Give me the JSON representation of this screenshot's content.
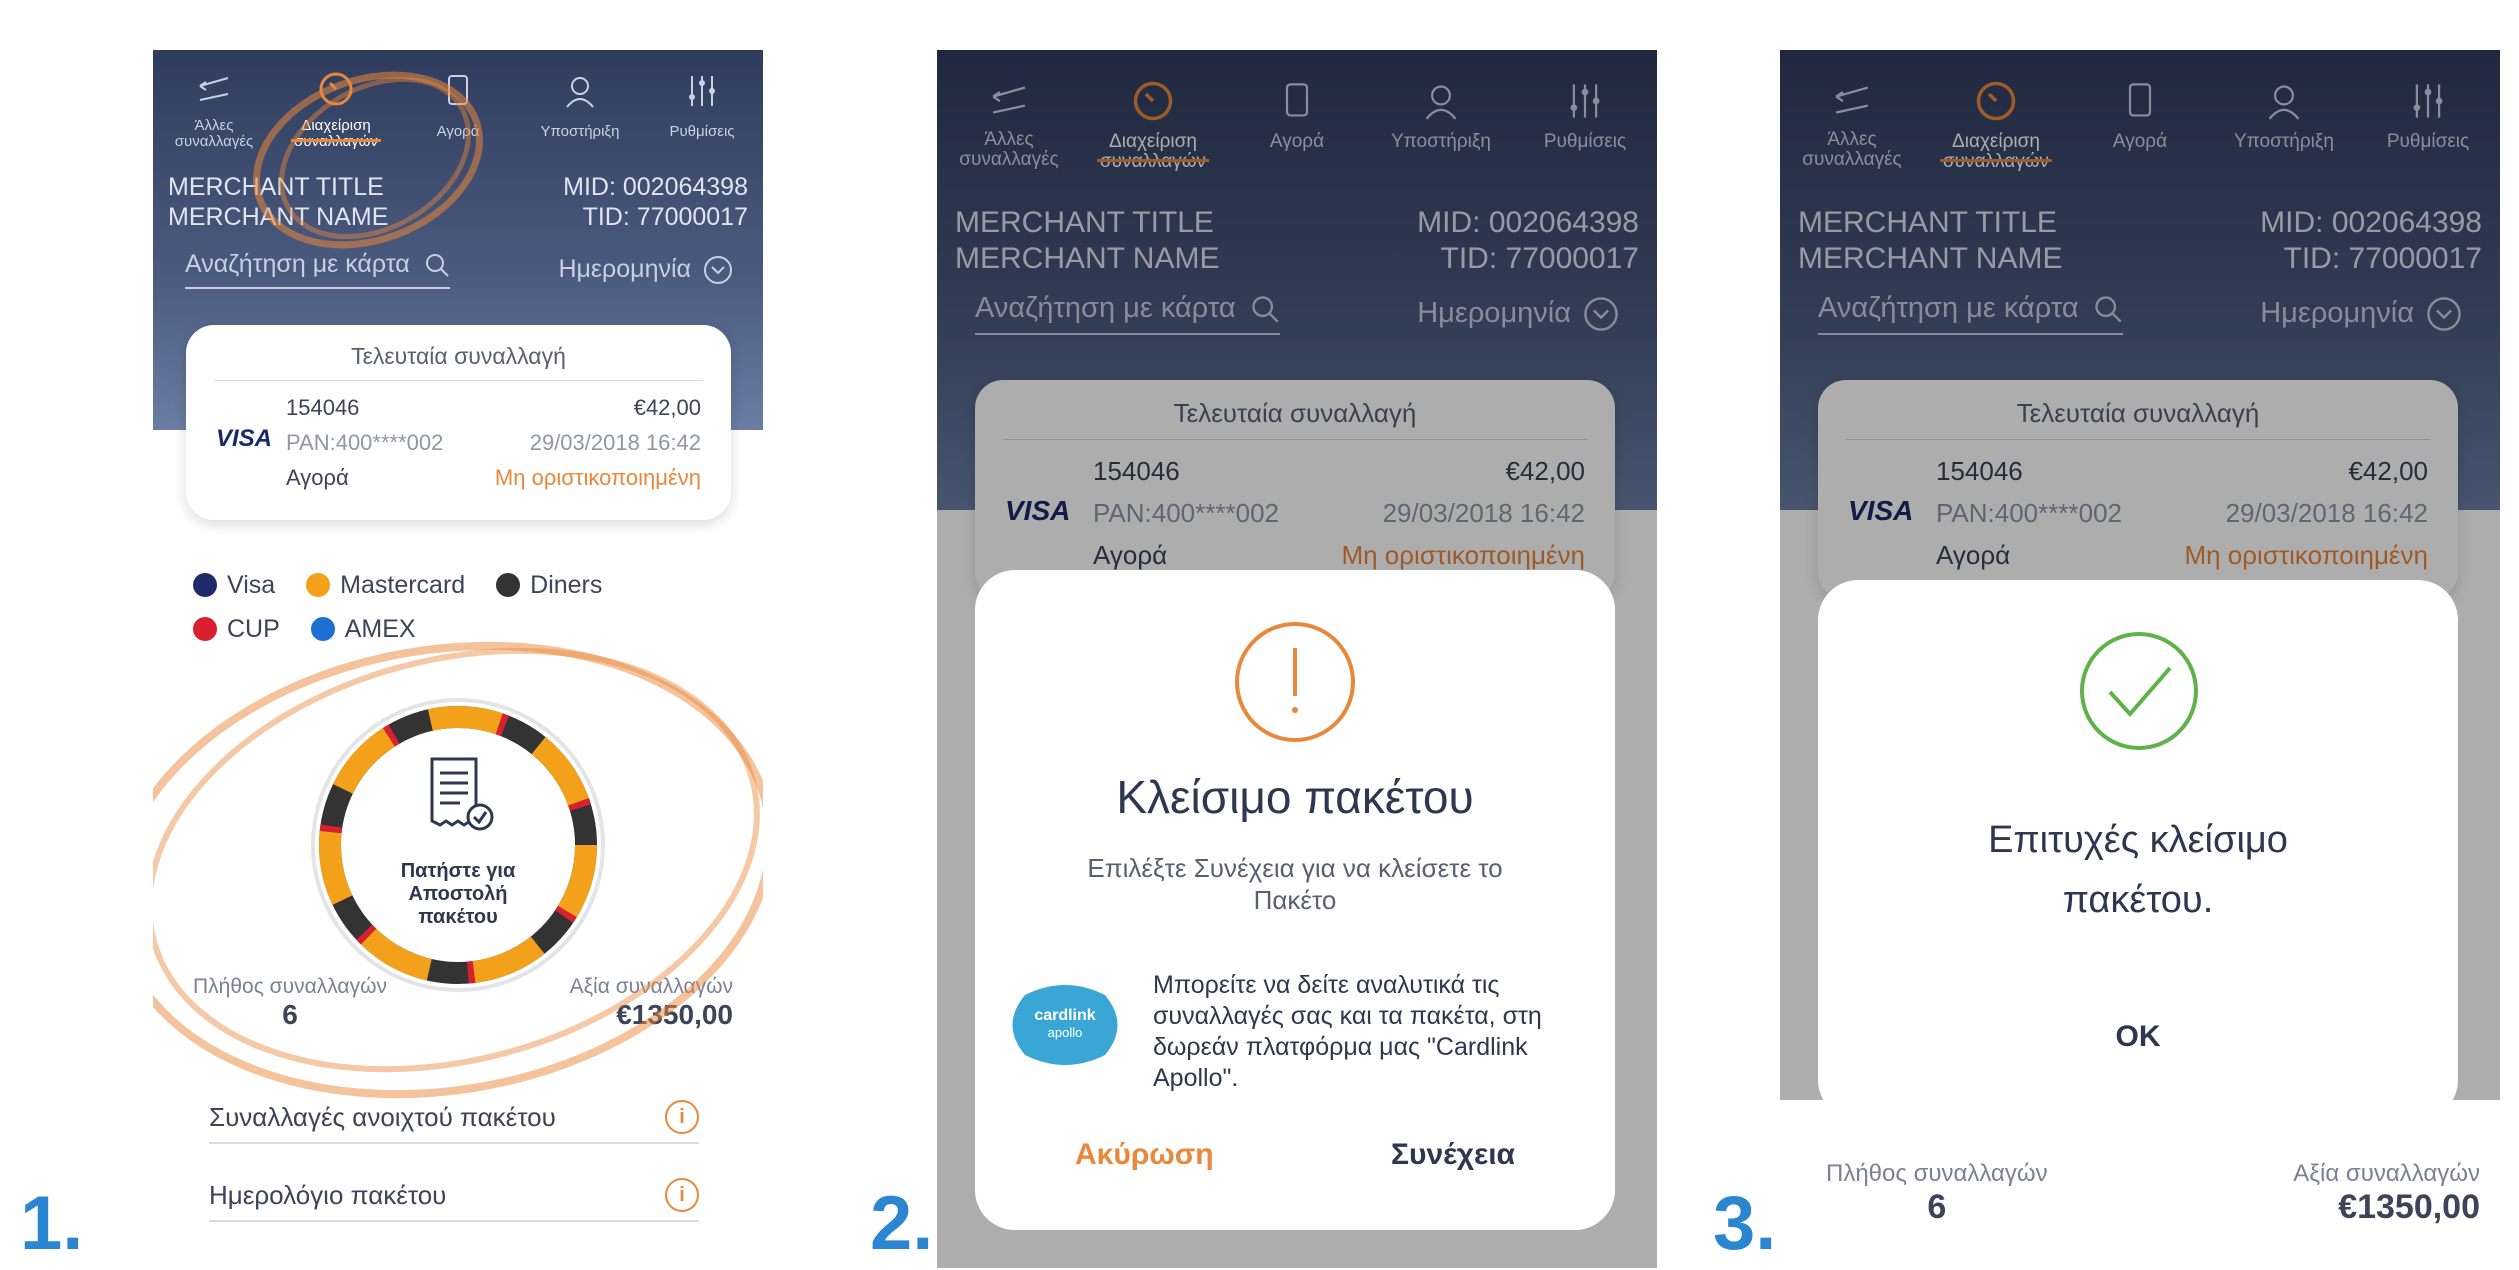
{
  "steps": [
    "1.",
    "2.",
    "3."
  ],
  "nav": {
    "items": [
      {
        "label_l1": "Άλλες",
        "label_l2": "συναλλαγές",
        "icon": "arrows-icon"
      },
      {
        "label_l1": "Διαχείριση",
        "label_l2": "συναλλαγών",
        "icon": "gauge-icon"
      },
      {
        "label_l1": "Αγορά",
        "label_l2": "",
        "icon": "card-hand-icon"
      },
      {
        "label_l1": "Υποστήριξη",
        "label_l2": "",
        "icon": "support-agent-icon"
      },
      {
        "label_l1": "Ρυθμίσεις",
        "label_l2": "",
        "icon": "sliders-icon"
      }
    ]
  },
  "merchant": {
    "title": "MERCHANT TITLE",
    "name": "MERCHANT NAME",
    "mid": "MID: 002064398",
    "tid": "TID: 77000017"
  },
  "search": {
    "placeholder": "Αναζήτηση με κάρτα",
    "date_label": "Ημερομηνία"
  },
  "last_tx": {
    "title": "Τελευταία συναλλαγή",
    "brand": "VISA",
    "id": "154046",
    "amount": "€42,00",
    "pan": "PAN:400****002",
    "datetime": "29/03/2018 16:42",
    "type": "Αγορά",
    "status": "Μη οριστικοποιημένη"
  },
  "legend": [
    {
      "name": "Visa",
      "color": "#1f2a6b"
    },
    {
      "name": "Mastercard",
      "color": "#f3a01a"
    },
    {
      "name": "Diners",
      "color": "#333333"
    },
    {
      "name": "CUP",
      "color": "#d8202f"
    },
    {
      "name": "AMEX",
      "color": "#1d6fd1"
    }
  ],
  "send_batch": {
    "l1": "Πατήστε για",
    "l2": "Αποστολή",
    "l3": "πακέτου"
  },
  "stats": {
    "count_label": "Πλήθος συναλλαγών",
    "count": "6",
    "value_label": "Αξία συναλλαγών",
    "value": "€1350,00"
  },
  "links": {
    "open_batch": "Συναλλαγές ανοιχτού πακέτου",
    "batch_log": "Ημερολόγιο πακέτου"
  },
  "close_modal": {
    "title": "Κλείσιμο πακέτου",
    "message": "Επιλέξτε Συνέχεια για να κλείσετε το Πακέτο",
    "info": "Μπορείτε να δείτε αναλυτικά τις συναλλαγές σας και τα πακέτα, στη δωρεάν πλατφόρμα μας \"Cardlink Apollo\".",
    "logo_l1": "cardlink",
    "logo_l2": "apollo",
    "cancel": "Ακύρωση",
    "continue": "Συνέχεια"
  },
  "success_modal": {
    "message_l1": "Επιτυχές κλείσιμο",
    "message_l2": "πακέτου.",
    "ok": "OK"
  },
  "colors": {
    "accent": "#e9873a",
    "header": "#2f3c5d",
    "success": "#5fb14a",
    "step": "#2a86d1"
  }
}
